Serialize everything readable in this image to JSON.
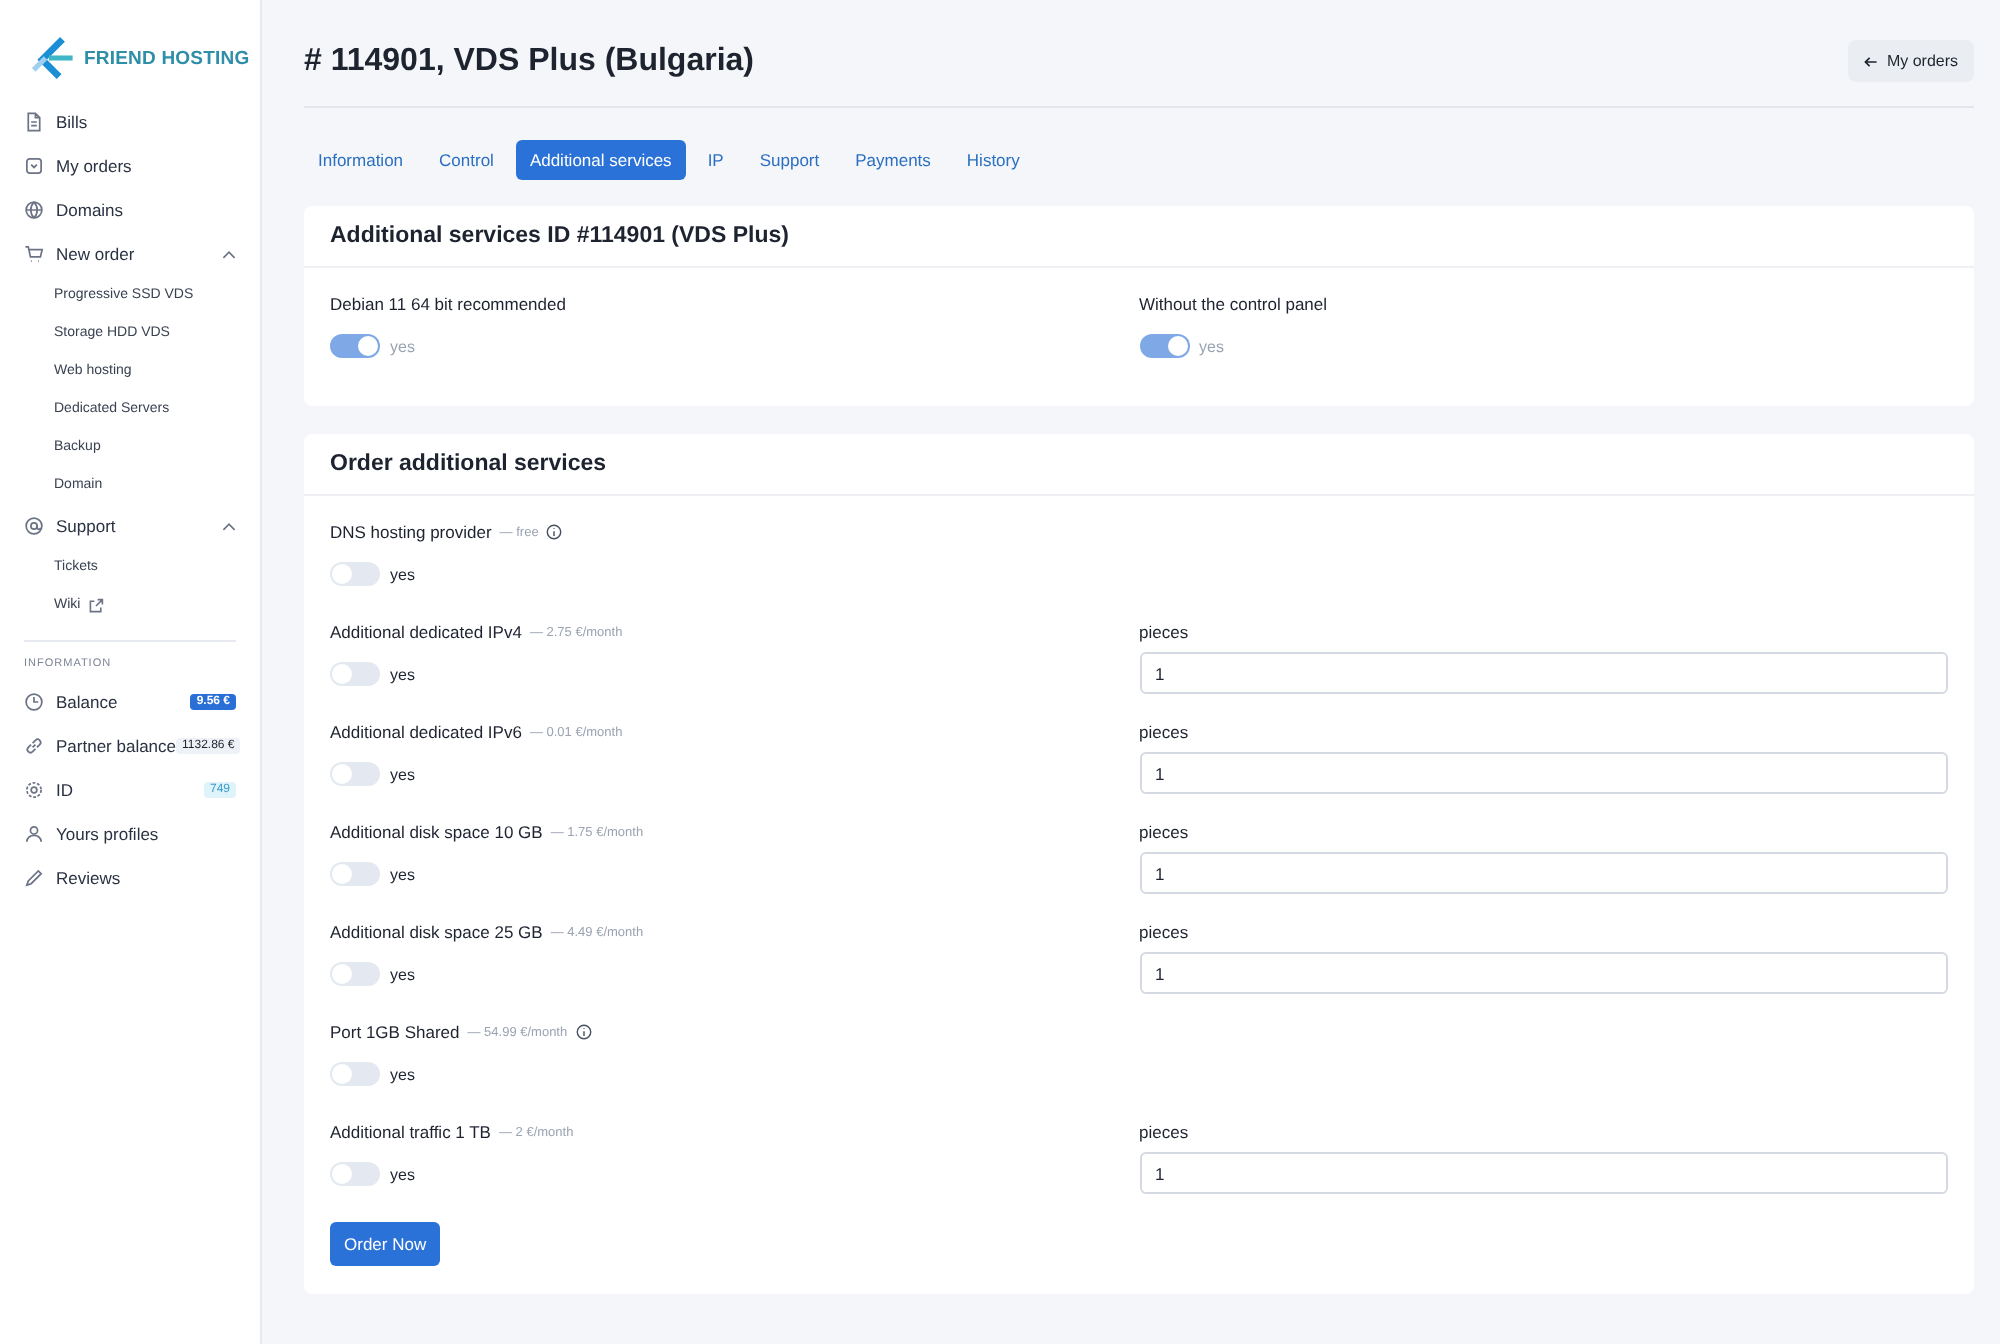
{
  "logo": {
    "text": "FRIEND HOSTING"
  },
  "sidebar": {
    "items": [
      {
        "label": "Bills"
      },
      {
        "label": "My orders"
      },
      {
        "label": "Domains"
      },
      {
        "label": "New order",
        "expanded": true,
        "children": [
          {
            "label": "Progressive SSD VDS",
            "external": false
          },
          {
            "label": "Storage HDD VDS",
            "external": false
          },
          {
            "label": "Web hosting",
            "external": false
          },
          {
            "label": "Dedicated Servers",
            "external": false
          },
          {
            "label": "Backup",
            "external": false
          },
          {
            "label": "Domain",
            "external": false
          }
        ]
      },
      {
        "label": "Support",
        "expanded": true,
        "children": [
          {
            "label": "Tickets",
            "external": false
          },
          {
            "label": "Wiki",
            "external": true
          }
        ]
      }
    ],
    "info_heading": "INFORMATION",
    "info_items": [
      {
        "label": "Balance",
        "badge": "9.56 €"
      },
      {
        "label": "Partner balance",
        "badge": "1132.86 €"
      },
      {
        "label": "ID",
        "badge": "749"
      },
      {
        "label": "Yours profiles"
      },
      {
        "label": "Reviews"
      }
    ]
  },
  "page": {
    "title": "# 114901, VDS Plus (Bulgaria)",
    "back_button": "My orders"
  },
  "tabs": [
    {
      "label": "Information",
      "selected": false
    },
    {
      "label": "Control",
      "selected": false
    },
    {
      "label": "Additional services",
      "selected": true
    },
    {
      "label": "IP",
      "selected": false
    },
    {
      "label": "Support",
      "selected": false
    },
    {
      "label": "Payments",
      "selected": false
    },
    {
      "label": "History",
      "selected": false
    }
  ],
  "current_services": {
    "title": "Additional services ID #114901 (VDS Plus)",
    "items": [
      {
        "label": "Debian 11 64 bit recommended",
        "checked": true,
        "disabled": true,
        "toggle_label": "yes"
      },
      {
        "label": "Without the control panel",
        "checked": true,
        "disabled": true,
        "toggle_label": "yes"
      }
    ]
  },
  "order_services": {
    "title": "Order additional services",
    "items": [
      {
        "name": "DNS hosting provider",
        "price": "— free",
        "info": true,
        "checked": false,
        "toggle_label": "yes"
      },
      {
        "name": "Additional dedicated IPv4",
        "price": "— 2.75 €/month",
        "info": false,
        "checked": false,
        "toggle_label": "yes",
        "pieces_label": "pieces",
        "pieces": "1"
      },
      {
        "name": "Additional dedicated IPv6",
        "price": "— 0.01 €/month",
        "info": false,
        "checked": false,
        "toggle_label": "yes",
        "pieces_label": "pieces",
        "pieces": "1"
      },
      {
        "name": "Additional disk space 10 GB",
        "price": "— 1.75 €/month",
        "info": false,
        "checked": false,
        "toggle_label": "yes",
        "pieces_label": "pieces",
        "pieces": "1"
      },
      {
        "name": "Additional disk space 25 GB",
        "price": "— 4.49 €/month",
        "info": false,
        "checked": false,
        "toggle_label": "yes",
        "pieces_label": "pieces",
        "pieces": "1"
      },
      {
        "name": "Port 1GB Shared",
        "price": "— 54.99 €/month",
        "info": true,
        "checked": false,
        "toggle_label": "yes"
      },
      {
        "name": "Additional traffic 1 TB",
        "price": "— 2 €/month",
        "info": false,
        "checked": false,
        "toggle_label": "yes",
        "pieces_label": "pieces",
        "pieces": "1"
      }
    ],
    "submit": "Order Now"
  }
}
